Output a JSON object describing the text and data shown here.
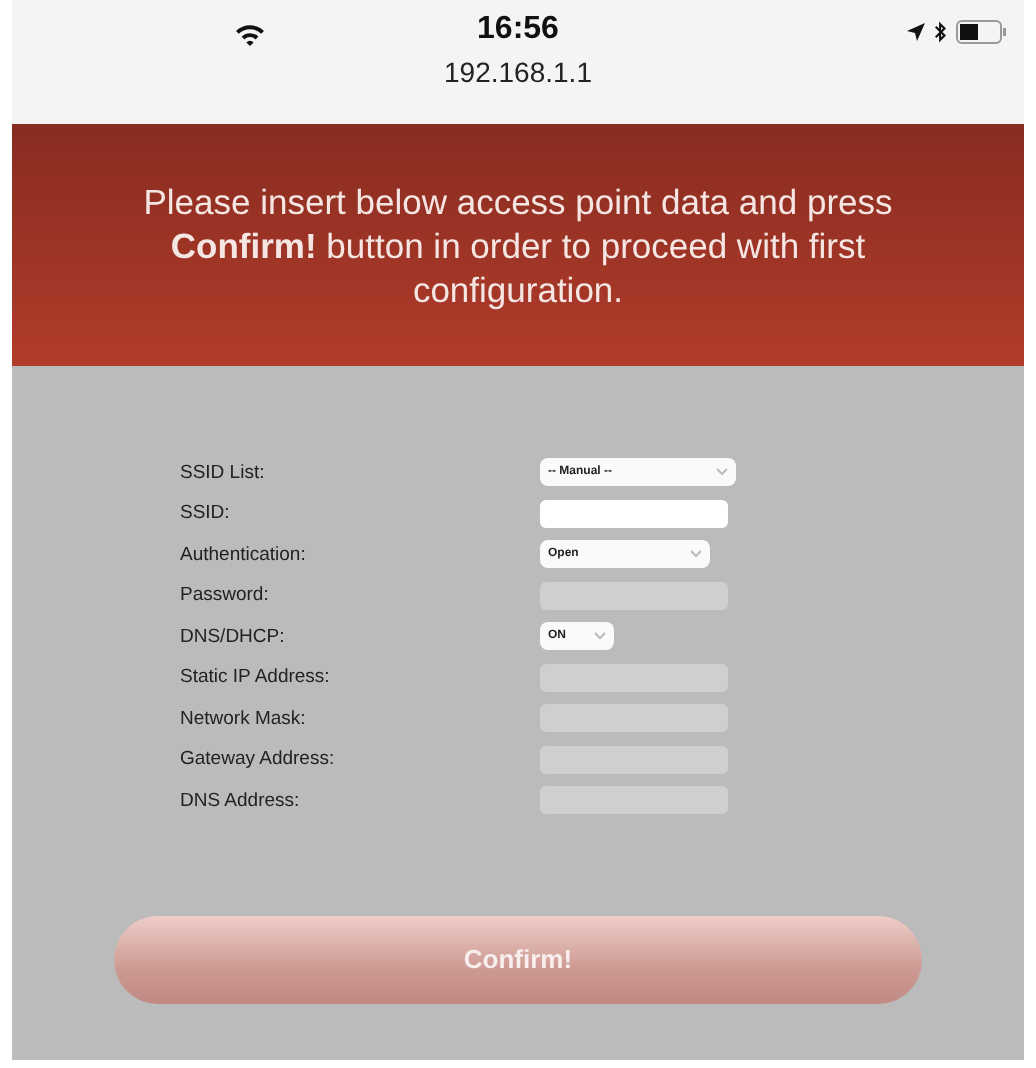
{
  "status_bar": {
    "time": "16:56",
    "url": "192.168.1.1"
  },
  "banner": {
    "text": "Please insert below access point data and press **Confirm!** button in order to proceed with first configuration."
  },
  "form": {
    "fields": [
      {
        "label": "SSID List:",
        "kind": "select",
        "value": "-- Manual --",
        "disabled": false
      },
      {
        "label": "SSID:",
        "kind": "text",
        "disabled": false
      },
      {
        "label": "Authentication:",
        "kind": "select",
        "value": "Open",
        "disabled": false
      },
      {
        "label": "Password:",
        "kind": "text",
        "disabled": true
      },
      {
        "label": "DNS/DHCP:",
        "kind": "select",
        "value": "ON",
        "disabled": false
      },
      {
        "label": "Static IP Address:",
        "kind": "text",
        "disabled": true
      },
      {
        "label": "Network Mask:",
        "kind": "text",
        "disabled": true
      },
      {
        "label": "Gateway Address:",
        "kind": "text",
        "disabled": true
      },
      {
        "label": "DNS Address:",
        "kind": "text",
        "disabled": true
      }
    ]
  },
  "confirm_button": {
    "label": "Confirm!",
    "disabled": true
  }
}
